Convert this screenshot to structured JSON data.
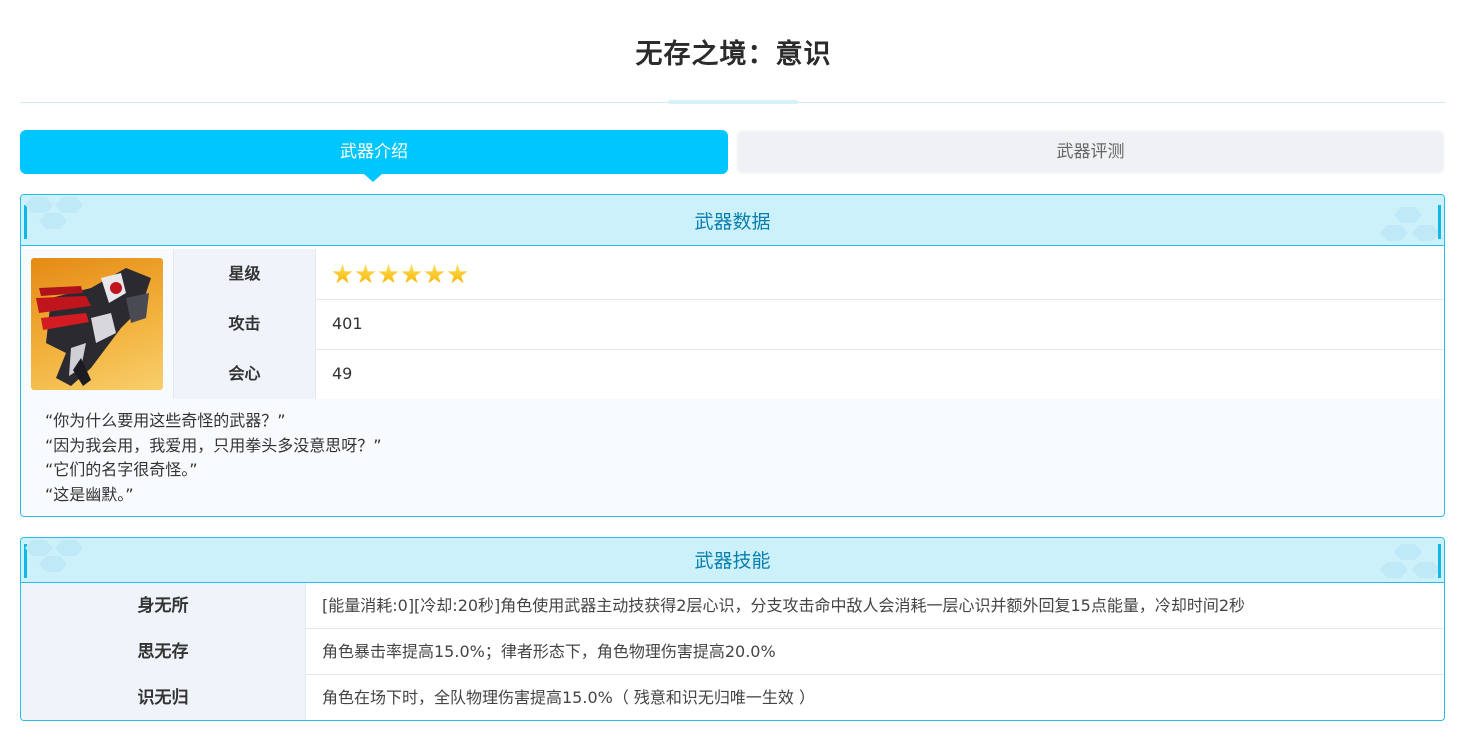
{
  "page": {
    "title": "无存之境：意识"
  },
  "tabs": [
    {
      "label": "武器介绍",
      "active": true
    },
    {
      "label": "武器评测",
      "active": false
    }
  ],
  "weapon_data": {
    "header": "武器数据",
    "image_icon": "gauntlet-weapon-icon",
    "stats": [
      {
        "label": "星级",
        "value": "",
        "stars": 6
      },
      {
        "label": "攻击",
        "value": "401"
      },
      {
        "label": "会心",
        "value": "49"
      }
    ],
    "quotes": [
      "“你为什么要用这些奇怪的武器？”",
      "“因为我会用，我爱用，只用拳头多没意思呀？”",
      "“它们的名字很奇怪。”",
      "“这是幽默。”"
    ]
  },
  "weapon_skills": {
    "header": "武器技能",
    "skills": [
      {
        "name": "身无所",
        "desc": "[能量消耗:0][冷却:20秒]角色使用武器主动技获得2层心识，分支攻击命中敌人会消耗一层心识并额外回复15点能量，冷却时间2秒"
      },
      {
        "name": "思无存",
        "desc": "角色暴击率提高15.0%；律者形态下，角色物理伤害提高20.0%"
      },
      {
        "name": "识无归",
        "desc": "角色在场下时，全队物理伤害提高15.0%（ 残意和识无归唯一生效 ）"
      }
    ]
  },
  "colors": {
    "accent": "#00c6ff",
    "panel_border": "#26bde8",
    "panel_header_bg": "#cdf1fb",
    "panel_header_text": "#0a7fae",
    "tab_inactive_bg": "#eff1f4",
    "star": "#f5b300"
  }
}
